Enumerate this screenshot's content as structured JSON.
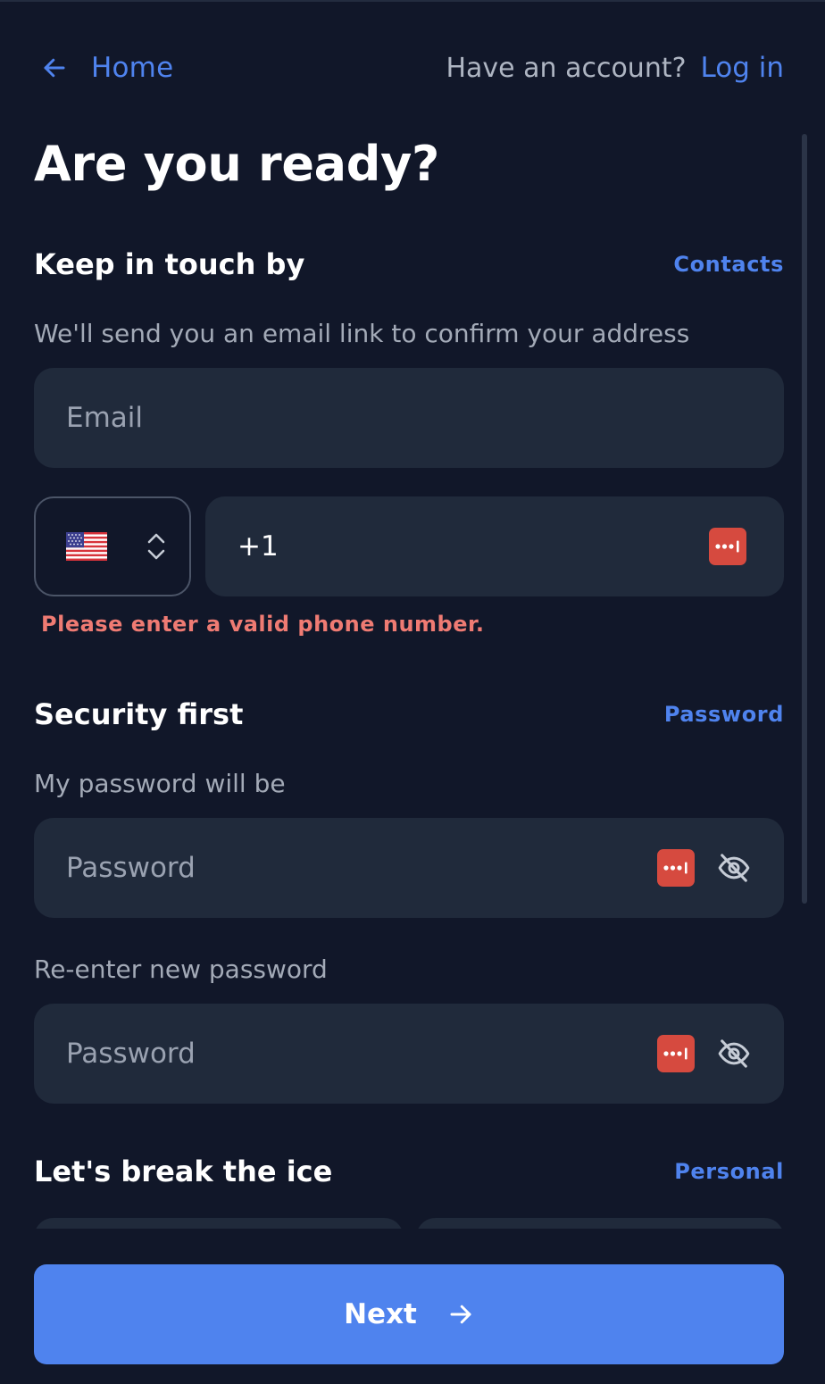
{
  "nav": {
    "home_label": "Home",
    "account_question": "Have an account?",
    "login_label": "Log in"
  },
  "title": "Are you ready?",
  "contact_section": {
    "heading": "Keep in touch by",
    "tag": "Contacts",
    "hint": "We'll send you an email link to confirm your address",
    "email": {
      "value": "",
      "placeholder": "Email"
    },
    "country_flag_icon": "us-flag-icon",
    "phone": {
      "value": "+1",
      "placeholder": ""
    },
    "error": "Please enter a valid phone number."
  },
  "security_section": {
    "heading": "Security first",
    "tag": "Password",
    "password_label": "My password will be",
    "password": {
      "value": "",
      "placeholder": "Password"
    },
    "confirm_label": "Re-enter new password",
    "confirm": {
      "value": "",
      "placeholder": "Password"
    }
  },
  "personal_section": {
    "heading": "Let's break the ice",
    "tag": "Personal"
  },
  "next_label": "Next",
  "colors": {
    "background": "#111729",
    "field": "#202a3b",
    "accent": "#4f83ee",
    "error": "#ef7b73",
    "password_manager": "#d64a3f"
  }
}
